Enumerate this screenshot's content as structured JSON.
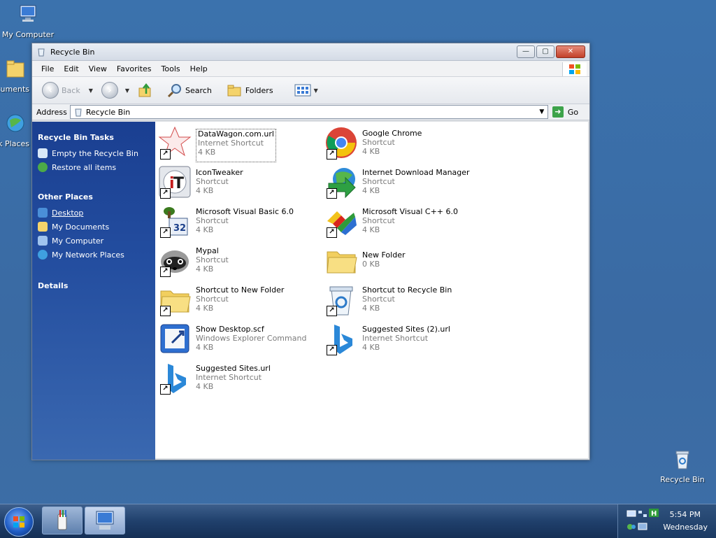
{
  "desktop": {
    "icons": [
      {
        "label": "My Computer"
      },
      {
        "label": "My Documents"
      },
      {
        "label": "My Network Places"
      },
      {
        "label": "Recycle Bin"
      }
    ]
  },
  "window": {
    "title": "Recycle Bin",
    "buttons": {
      "minimize": "—",
      "maximize": "▢",
      "close": "✕"
    }
  },
  "menubar": {
    "items": [
      "File",
      "Edit",
      "View",
      "Favorites",
      "Tools",
      "Help"
    ]
  },
  "toolbar": {
    "back": "Back",
    "search": "Search",
    "folders": "Folders"
  },
  "address": {
    "label": "Address",
    "value": "Recycle Bin",
    "go": "Go"
  },
  "leftpane": {
    "tasks_title": "Recycle Bin Tasks",
    "tasks": [
      "Empty the Recycle Bin",
      "Restore all items"
    ],
    "places_title": "Other Places",
    "places": [
      "Desktop",
      "My Documents",
      "My Computer",
      "My Network Places"
    ],
    "details_title": "Details"
  },
  "items": [
    {
      "name": "DataWagon.com.url",
      "type": "Internet Shortcut",
      "size": "4 KB",
      "icon": "datawagon-icon"
    },
    {
      "name": "Google Chrome",
      "type": "Shortcut",
      "size": "4 KB",
      "icon": "chrome-icon"
    },
    {
      "name": "IconTweaker",
      "type": "Shortcut",
      "size": "4 KB",
      "icon": "icontweaker-icon"
    },
    {
      "name": "Internet Download Manager",
      "type": "Shortcut",
      "size": "4 KB",
      "icon": "idm-icon"
    },
    {
      "name": "Microsoft Visual Basic 6.0",
      "type": "Shortcut",
      "size": "4 KB",
      "icon": "vb6-icon"
    },
    {
      "name": "Microsoft Visual C++ 6.0",
      "type": "Shortcut",
      "size": "4 KB",
      "icon": "vcpp-icon"
    },
    {
      "name": "Mypal",
      "type": "Shortcut",
      "size": "4 KB",
      "icon": "mypal-icon"
    },
    {
      "name": "New Folder",
      "type": "",
      "size": "0 KB",
      "icon": "folder-icon"
    },
    {
      "name": "Shortcut to New Folder",
      "type": "Shortcut",
      "size": "4 KB",
      "icon": "folder-icon"
    },
    {
      "name": "Shortcut to Recycle Bin",
      "type": "Shortcut",
      "size": "4 KB",
      "icon": "recycle-bin-icon"
    },
    {
      "name": "Show Desktop.scf",
      "type": "Windows Explorer Command",
      "size": "4 KB",
      "icon": "show-desktop-icon"
    },
    {
      "name": "Suggested Sites (2).url",
      "type": "Internet Shortcut",
      "size": "4 KB",
      "icon": "bing-icon"
    },
    {
      "name": "Suggested Sites.url",
      "type": "Internet Shortcut",
      "size": "4 KB",
      "icon": "bing-icon"
    }
  ],
  "taskbar": {
    "time": "5:54 PM",
    "day": "Wednesday"
  }
}
